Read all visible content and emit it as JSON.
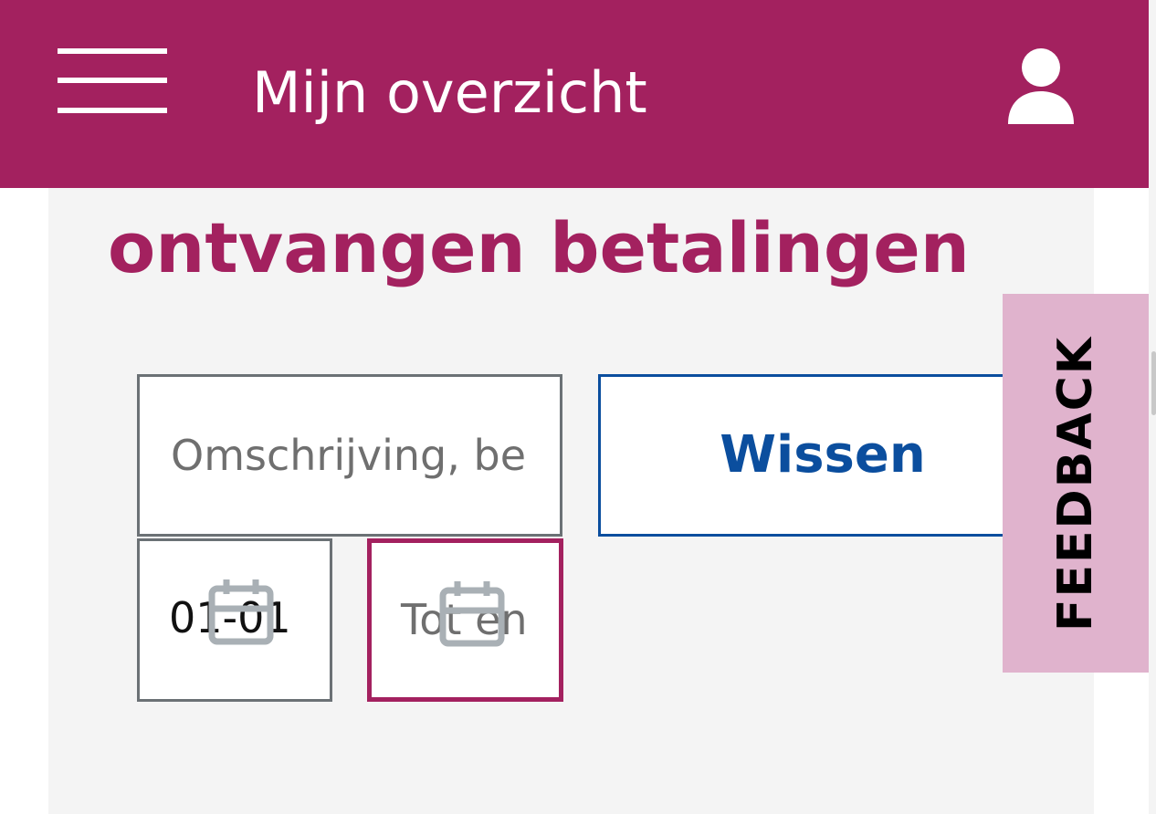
{
  "header": {
    "title": "Mijn overzicht",
    "menu_icon": "hamburger-menu-icon",
    "user_icon": "user-icon",
    "background_color": "#a3215f"
  },
  "main": {
    "heading": "ontvangen betalingen",
    "heading_color": "#a3215f"
  },
  "filters": {
    "search": {
      "placeholder": "Omschrijving, be",
      "value": ""
    },
    "clear_button_label": "Wissen",
    "date_from": {
      "value": "01-01",
      "icon": "calendar-icon"
    },
    "date_to": {
      "placeholder": "Tot en",
      "icon": "calendar-icon"
    }
  },
  "feedback": {
    "label": "FEEDBACK",
    "background_color": "#e0b3cd"
  },
  "colors": {
    "accent": "#a3215f",
    "link_blue": "#0b4e9e",
    "page_background": "#f4f4f4"
  }
}
